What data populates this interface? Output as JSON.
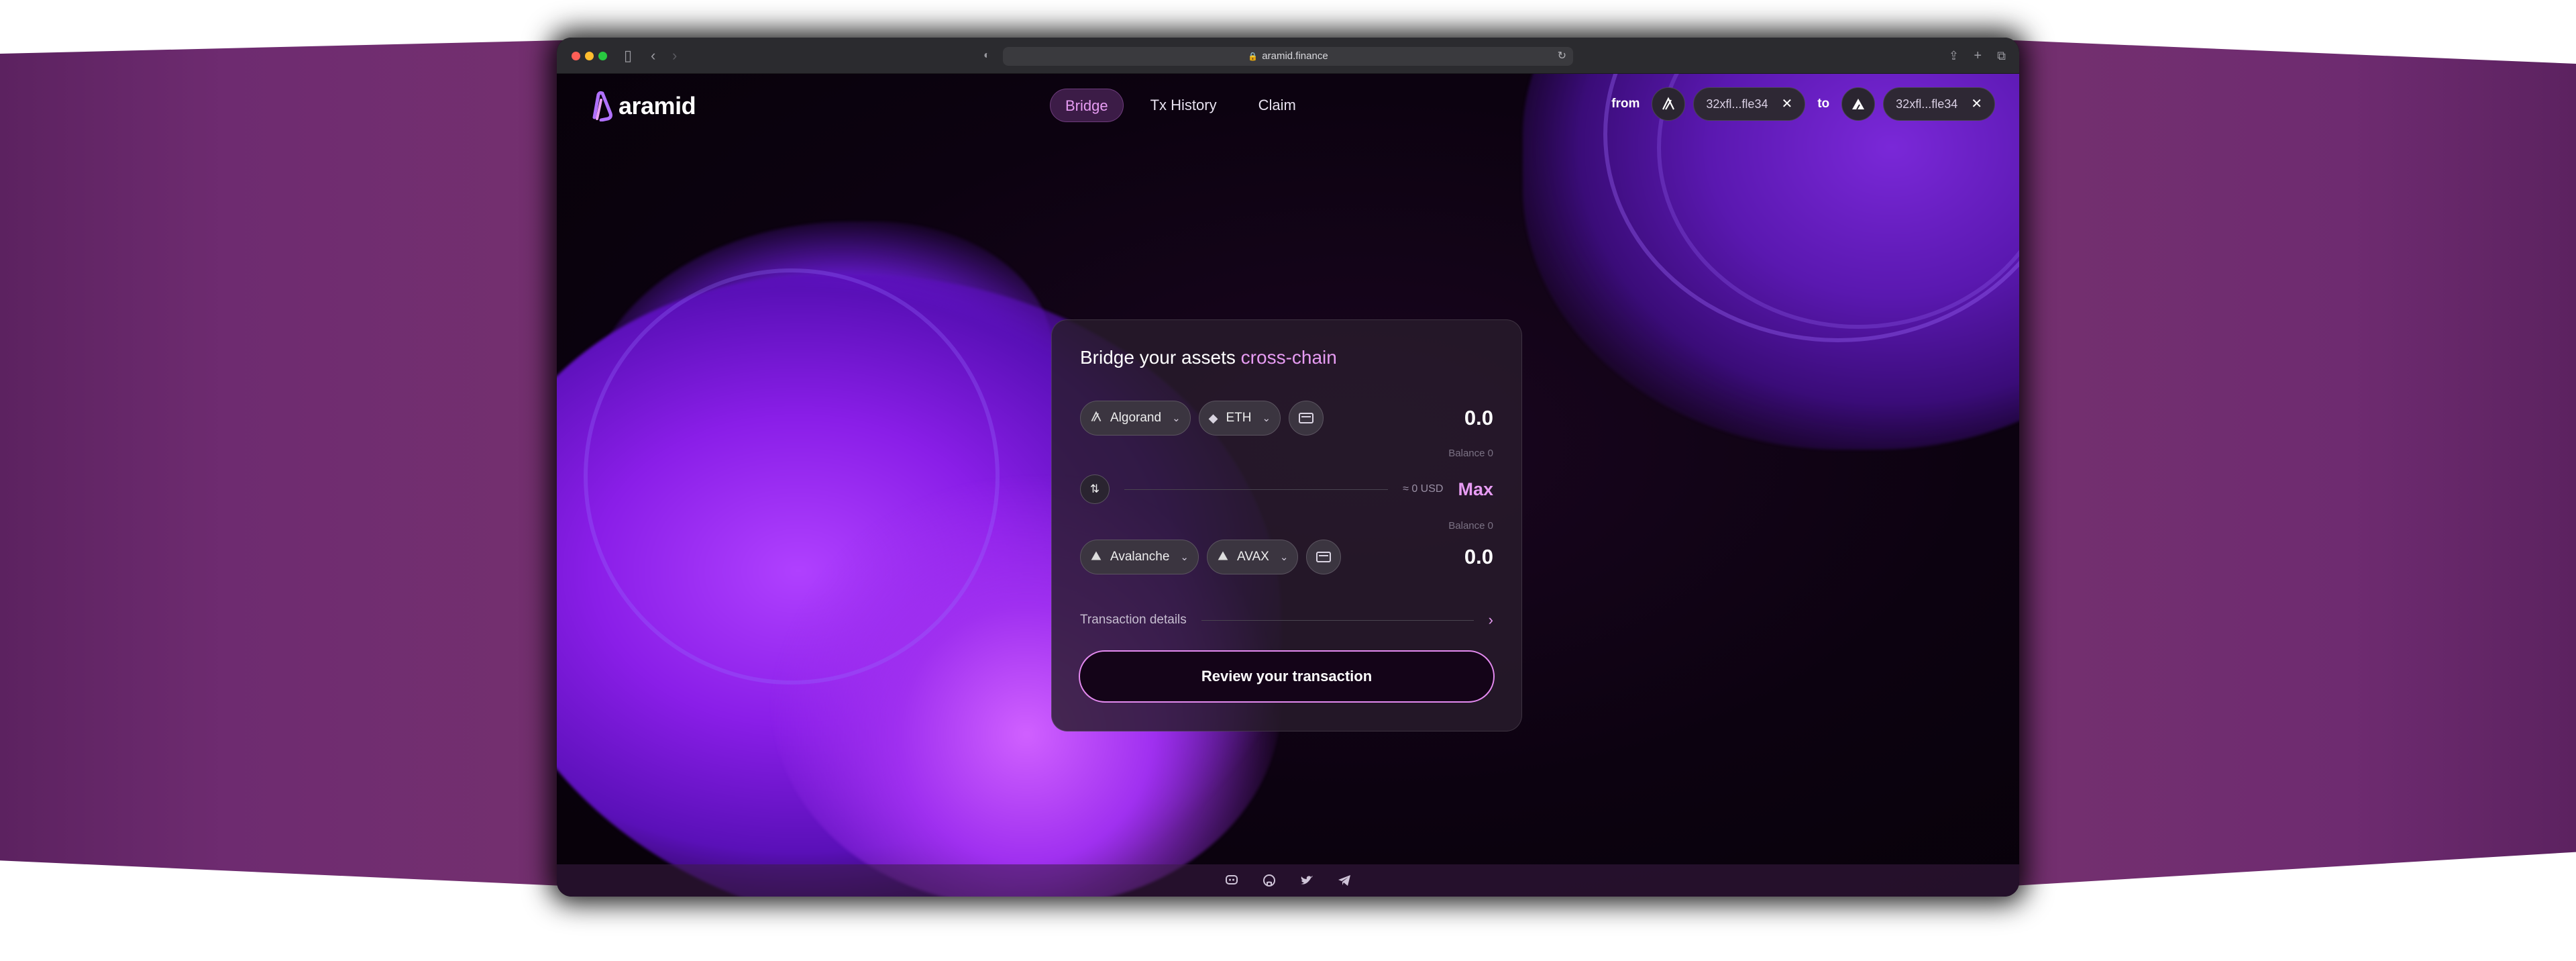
{
  "browser": {
    "url": "aramid.finance"
  },
  "app": {
    "logo_text": "aramid"
  },
  "nav": {
    "items": [
      {
        "label": "Bridge",
        "active": true
      },
      {
        "label": "Tx History",
        "active": false
      },
      {
        "label": "Claim",
        "active": false
      }
    ]
  },
  "wallets": {
    "from_label": "from",
    "from_address": "32xfl...fle34",
    "to_label": "to",
    "to_address": "32xfl...fle34"
  },
  "bridge": {
    "title": "Bridge your assets",
    "title_accent": "cross-chain",
    "source": {
      "chain": "Algorand",
      "token": "ETH",
      "amount": "0.0",
      "balance": "Balance 0"
    },
    "usd_estimate": "≈ 0 USD",
    "max_label": "Max",
    "destination": {
      "chain": "Avalanche",
      "token": "AVAX",
      "amount": "0.0",
      "balance": "Balance 0"
    },
    "details_label": "Transaction details",
    "review_label": "Review your transaction"
  },
  "footer": {
    "icons": [
      "discord-icon",
      "github-icon",
      "twitter-icon",
      "telegram-icon"
    ]
  },
  "colors": {
    "accent": "#e79cf3",
    "background": "#0c0210",
    "card": "#281c2c"
  }
}
